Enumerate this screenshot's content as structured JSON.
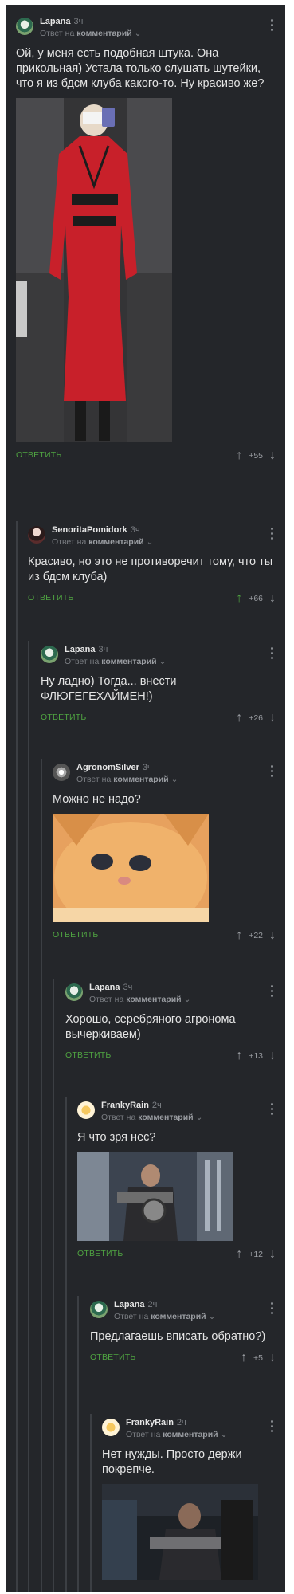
{
  "comments": [
    {
      "user": "Lapana",
      "time": "3ч",
      "reply_to": "",
      "reply_word": "Ответ на",
      "reply_target": "комментарий",
      "text": "Ой, у меня есть подобная штука. Она прикольная) Устала только слушать шутейки, что я из бдсм клуба какого-то. Ну красиво же?",
      "reply": "ОТВЕТИТЬ",
      "score": "+55"
    },
    {
      "user": "SenoritaPomidork",
      "time": "3ч",
      "reply_word": "Ответ на",
      "reply_target": "комментарий",
      "text": "Красиво, но это не противоречит тому, что ты из бдсм клуба)",
      "reply": "ОТВЕТИТЬ",
      "score": "+66"
    },
    {
      "user": "Lapana",
      "time": "3ч",
      "reply_word": "Ответ на",
      "reply_target": "комментарий",
      "text": "Ну ладно) Тогда... внести ФЛЮГЕГЕХАЙМЕН!)",
      "reply": "ОТВЕТИТЬ",
      "score": "+26"
    },
    {
      "user": "AgronomSilver",
      "time": "3ч",
      "reply_word": "Ответ на",
      "reply_target": "комментарий",
      "text": "Можно не надо?",
      "reply": "ОТВЕТИТЬ",
      "score": "+22"
    },
    {
      "user": "Lapana",
      "time": "3ч",
      "reply_word": "Ответ на",
      "reply_target": "комментарий",
      "text": "Хорошо, серебряного агронома вычеркиваем)",
      "reply": "ОТВЕТИТЬ",
      "score": "+13"
    },
    {
      "user": "FrankyRain",
      "time": "2ч",
      "reply_word": "Ответ на",
      "reply_target": "комментарий",
      "text": "Я что зря нес?",
      "reply": "ОТВЕТИТЬ",
      "score": "+12"
    },
    {
      "user": "Lapana",
      "time": "2ч",
      "reply_word": "Ответ на",
      "reply_target": "комментарий",
      "text": "Предлагаешь вписать обратно?)",
      "reply": "ОТВЕТИТЬ",
      "score": "+5"
    },
    {
      "user": "FrankyRain",
      "time": "2ч",
      "reply_word": "Ответ на",
      "reply_target": "комментарий",
      "text": "Нет нужды. Просто держи покрепче.",
      "reply": "",
      "score": ""
    }
  ],
  "colors": {
    "background": "#24262a",
    "accent": "#4fa341",
    "muted": "#7a7d82"
  },
  "icons": {
    "up": "arrow-up-icon",
    "down": "arrow-down-icon",
    "more": "more-vertical-icon",
    "chevron": "chevron-down-icon"
  }
}
